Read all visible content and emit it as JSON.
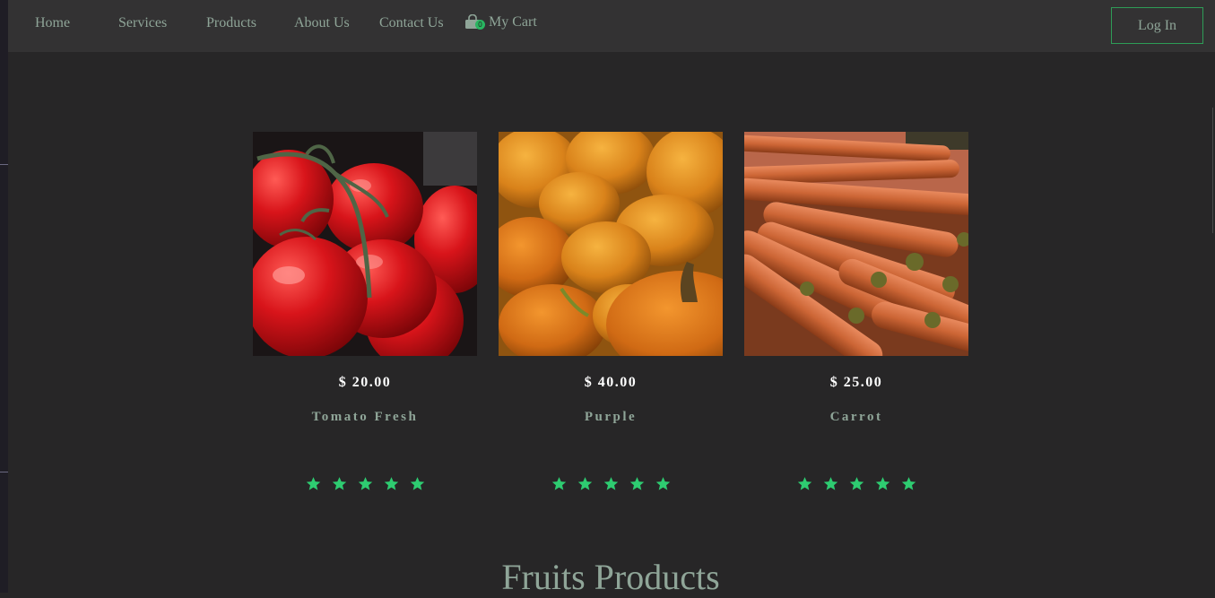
{
  "nav": {
    "items": [
      {
        "label": "Home",
        "name": "nav-home"
      },
      {
        "label": "Services",
        "name": "nav-services"
      },
      {
        "label": "Products",
        "name": "nav-products"
      },
      {
        "label": "About Us",
        "name": "nav-about-us"
      },
      {
        "label": "Contact Us",
        "name": "nav-contact-us"
      }
    ],
    "cart": {
      "label": "My Cart",
      "count": "0",
      "icon": "shopping-bag-icon"
    },
    "login_label": "Log In"
  },
  "products": [
    {
      "price": "$ 20.00",
      "name": "Tomato Fresh",
      "rating": 5,
      "image": "tomato-image"
    },
    {
      "price": "$ 40.00",
      "name": "Purple",
      "rating": 5,
      "image": "pumpkin-image"
    },
    {
      "price": "$ 25.00",
      "name": "Carrot",
      "rating": 5,
      "image": "carrot-image"
    }
  ],
  "section_title": "Fruits Products",
  "colors": {
    "background": "#272627",
    "navbar": "#333233",
    "accent": "#2ecc71",
    "text_muted": "#8fa598"
  }
}
